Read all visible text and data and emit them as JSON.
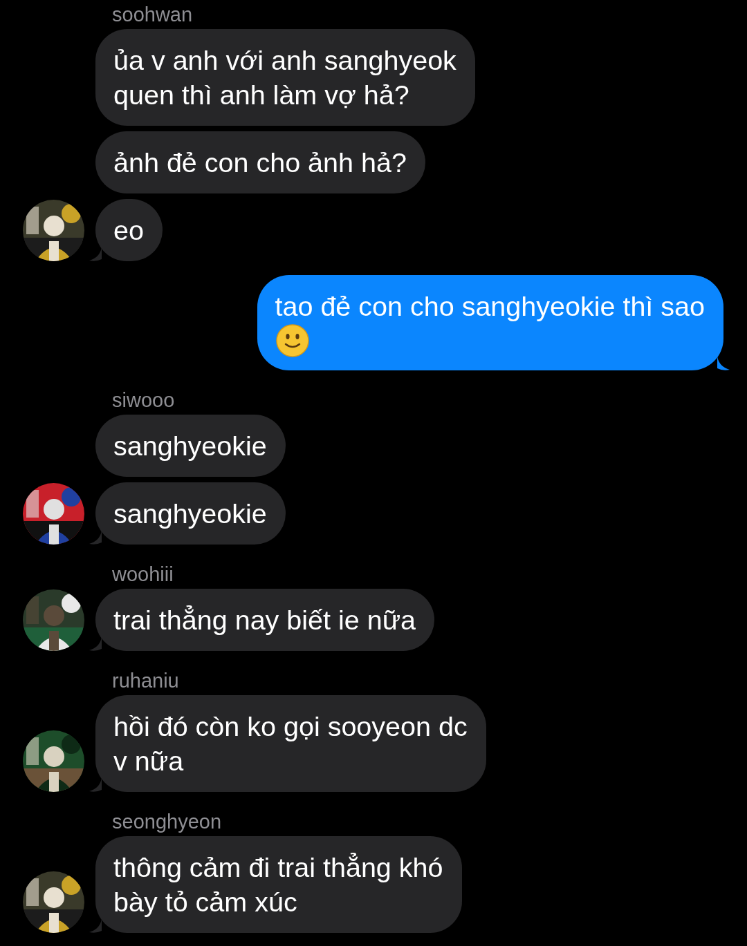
{
  "messages": [
    {
      "sender": "soohwan",
      "outgoing": false,
      "avatar": {
        "kind": "picture"
      },
      "bubbles": [
        {
          "text": "ủa v anh với anh sanghyeok\nquen thì anh làm vợ hả?"
        },
        {
          "text": "ảnh đẻ con cho ảnh hả?"
        },
        {
          "text": "eo"
        }
      ]
    },
    {
      "outgoing": true,
      "bubbles": [
        {
          "text": "tao đẻ con cho sanghyeokie thì sao",
          "emoji": true
        }
      ]
    },
    {
      "sender": "siwooo",
      "outgoing": false,
      "avatar": {
        "kind": "picture"
      },
      "bubbles": [
        {
          "text": "sanghyeokie"
        },
        {
          "text": "sanghyeokie"
        }
      ]
    },
    {
      "sender": "woohiii",
      "outgoing": false,
      "avatar": {
        "kind": "picture"
      },
      "bubbles": [
        {
          "text": "trai thẳng nay biết ie nữa"
        }
      ]
    },
    {
      "sender": "ruhaniu",
      "outgoing": false,
      "avatar": {
        "kind": "picture"
      },
      "bubbles": [
        {
          "text": "hồi đó còn ko gọi sooyeon dc\nv nữa"
        }
      ]
    },
    {
      "sender": "seonghyeon",
      "outgoing": false,
      "avatar": {
        "kind": "picture"
      },
      "bubbles": [
        {
          "text": "thông cảm đi trai thẳng khó\nbày tỏ cảm xúc"
        }
      ]
    }
  ]
}
